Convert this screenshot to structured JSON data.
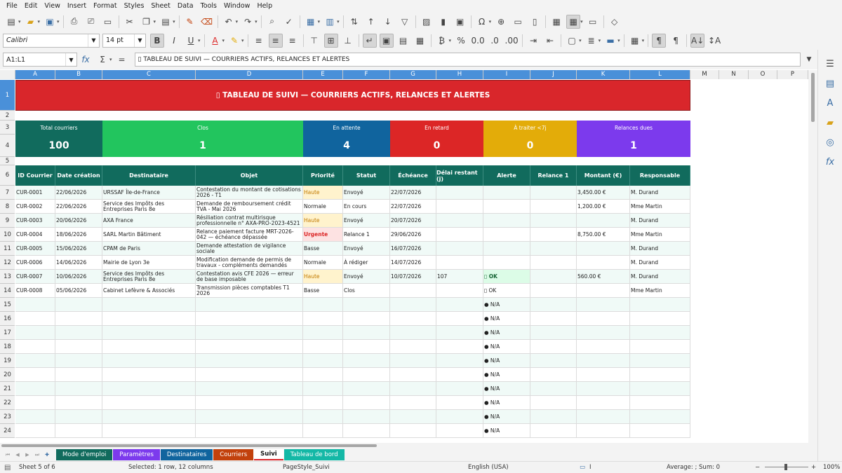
{
  "menu": [
    "File",
    "Edit",
    "View",
    "Insert",
    "Format",
    "Styles",
    "Sheet",
    "Data",
    "Tools",
    "Window",
    "Help"
  ],
  "font": {
    "name": "Calibri",
    "size": "14 pt"
  },
  "formula_bar": {
    "cell_ref": "A1:L1",
    "content": "▯ TABLEAU DE SUIVI — COURRIERS ACTIFS, RELANCES ET ALERTES"
  },
  "columns": [
    "A",
    "B",
    "C",
    "D",
    "E",
    "F",
    "G",
    "H",
    "I",
    "J",
    "K",
    "L",
    "M",
    "N",
    "O",
    "P"
  ],
  "rows": [
    "1",
    "2",
    "3",
    "4",
    "5",
    "6",
    "7",
    "8",
    "9",
    "10",
    "11",
    "12",
    "13",
    "14",
    "15",
    "16",
    "17",
    "18",
    "19",
    "20",
    "21",
    "22",
    "23",
    "24"
  ],
  "title": "▯ TABLEAU DE SUIVI — COURRIERS ACTIFS, RELANCES ET ALERTES",
  "kpis": [
    {
      "label": "Total courriers",
      "value": "100",
      "color": "#116b5d"
    },
    {
      "label": "Clos",
      "value": "1",
      "color": "#22c55e"
    },
    {
      "label": "En attente",
      "value": "4",
      "color": "#10649e"
    },
    {
      "label": "En retard",
      "value": "0",
      "color": "#dc2626"
    },
    {
      "label": "À traiter <7j",
      "value": "0",
      "color": "#e3ac09"
    },
    {
      "label": "Relances dues",
      "value": "1",
      "color": "#7c3aed"
    }
  ],
  "headers": [
    "ID Courrier",
    "Date création",
    "Destinataire",
    "Objet",
    "Priorité",
    "Statut",
    "Échéance",
    "Délai restant (j)",
    "Alerte",
    "Relance 1",
    "Montant (€)",
    "Responsable"
  ],
  "records": [
    [
      "CUR-0001",
      "22/06/2026",
      "URSSAF Île-de-France",
      "Contestation du montant de cotisations 2026 - T1",
      "Haute",
      "Envoyé",
      "22/07/2026",
      "",
      "",
      "",
      "3,450.00 €",
      "M. Durand"
    ],
    [
      "CUR-0002",
      "22/06/2026",
      "Service des Impôts des Entreprises Paris 8e",
      "Demande de remboursement crédit TVA - Mai 2026",
      "Normale",
      "En cours",
      "22/07/2026",
      "",
      "",
      "",
      "1,200.00 €",
      "Mme Martin"
    ],
    [
      "CUR-0003",
      "20/06/2026",
      "AXA France",
      "Résiliation contrat multirisque professionnelle n° AXA-PRO-2023-4521",
      "Haute",
      "Envoyé",
      "20/07/2026",
      "",
      "",
      "",
      "",
      "M. Durand"
    ],
    [
      "CUR-0004",
      "18/06/2026",
      "SARL Martin Bâtiment",
      "Relance paiement facture MRT-2026-042 — échéance dépassée",
      "Urgente",
      "Relance 1",
      "29/06/2026",
      "",
      "",
      "",
      "8,750.00 €",
      "Mme Martin"
    ],
    [
      "CUR-0005",
      "15/06/2026",
      "CPAM de Paris",
      "Demande attestation de vigilance sociale",
      "Basse",
      "Envoyé",
      "16/07/2026",
      "",
      "",
      "",
      "",
      "M. Durand"
    ],
    [
      "CUR-0006",
      "14/06/2026",
      "Mairie de Lyon 3e",
      "Modification demande de permis de travaux - compléments demandés",
      "Normale",
      "À rédiger",
      "14/07/2026",
      "",
      "",
      "",
      "",
      "M. Durand"
    ],
    [
      "CUR-0007",
      "10/06/2026",
      "Service des Impôts des Entreprises Paris 8e",
      "Contestation avis CFE 2026 — erreur de base imposable",
      "Haute",
      "Envoyé",
      "10/07/2026",
      "107",
      "▯ OK",
      "",
      "560.00 €",
      "M. Durand"
    ],
    [
      "CUR-0008",
      "05/06/2026",
      "Cabinet Lefèvre & Associés",
      "Transmission pièces comptables T1 2026",
      "Basse",
      "Clos",
      "",
      "",
      "▯ OK",
      "",
      "",
      "Mme Martin"
    ]
  ],
  "empty_alert": "● N/A",
  "sheet_tabs": [
    {
      "name": "Mode d'emploi",
      "color": "#116b5d"
    },
    {
      "name": "Paramètres",
      "color": "#7c3aed"
    },
    {
      "name": "Destinataires",
      "color": "#10649e"
    },
    {
      "name": "Courriers",
      "color": "#c2410c"
    },
    {
      "name": "Suivi",
      "color": "#ffffff"
    },
    {
      "name": "Tableau de bord",
      "color": "#14b8a6"
    }
  ],
  "status": {
    "sheet": "Sheet 5 of 6",
    "selection": "Selected: 1 row, 12 columns",
    "page_style": "PageStyle_Suivi",
    "language": "English (USA)",
    "summary": "Average: ; Sum: 0",
    "zoom": "100%"
  }
}
